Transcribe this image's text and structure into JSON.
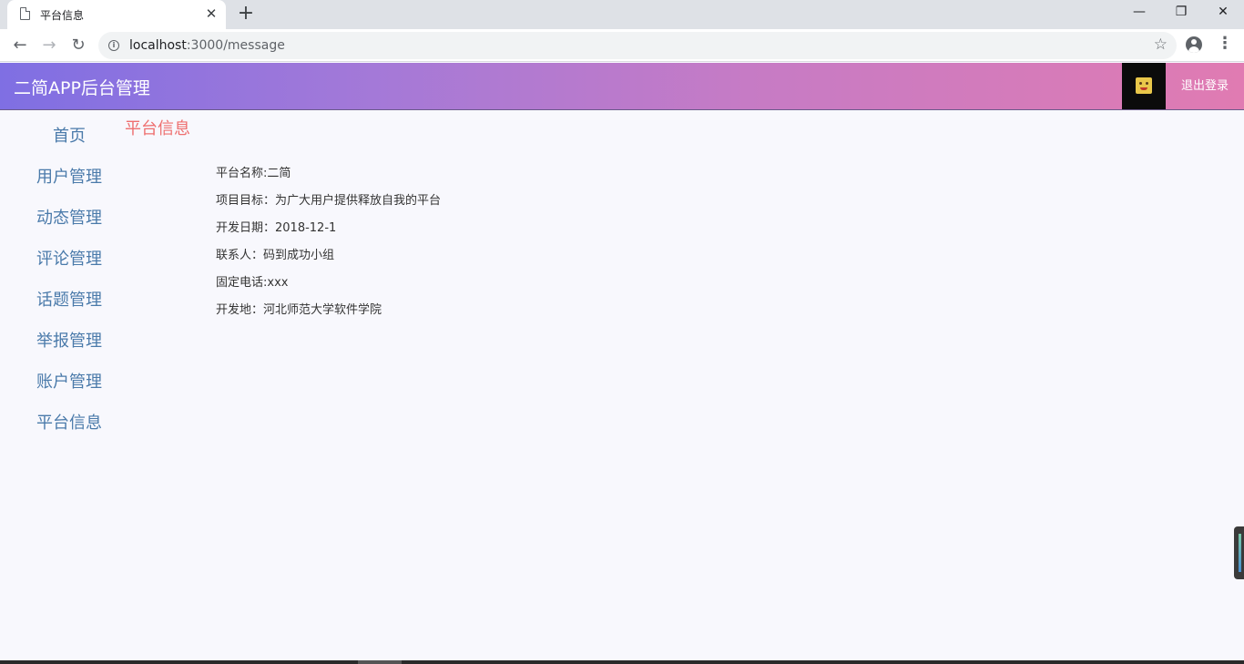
{
  "browser": {
    "tab_title": "平台信息",
    "tab_close": "✕",
    "new_tab": "+",
    "url_host": "localhost",
    "url_path": ":3000/message",
    "window_controls": {
      "minimize": "—",
      "restore": "❐",
      "close": "✕"
    },
    "nav": {
      "back": "←",
      "forward": "→",
      "reload": "↻"
    },
    "star": "☆",
    "menu": "⋮"
  },
  "header": {
    "app_title": "二简APP后台管理",
    "logout_label": "退出登录"
  },
  "sidebar": {
    "items": [
      {
        "label": "首页"
      },
      {
        "label": "用户管理"
      },
      {
        "label": "动态管理"
      },
      {
        "label": "评论管理"
      },
      {
        "label": "话题管理"
      },
      {
        "label": "举报管理"
      },
      {
        "label": "账户管理"
      },
      {
        "label": "平台信息"
      }
    ]
  },
  "main": {
    "heading": "平台信息",
    "info": [
      "平台名称:二简",
      "项目目标：为广大用户提供释放自我的平台",
      "开发日期：2018-12-1",
      "联系人：码到成功小组",
      "固定电话:xxx",
      "开发地：河北师范大学软件学院"
    ]
  },
  "colors": {
    "header_gradient_start": "#7f6fe3",
    "header_gradient_end": "#e07bb2",
    "sidebar_link": "#4a7aaa",
    "heading_accent": "#ee6f6f",
    "page_bg": "#f8f8fd"
  }
}
